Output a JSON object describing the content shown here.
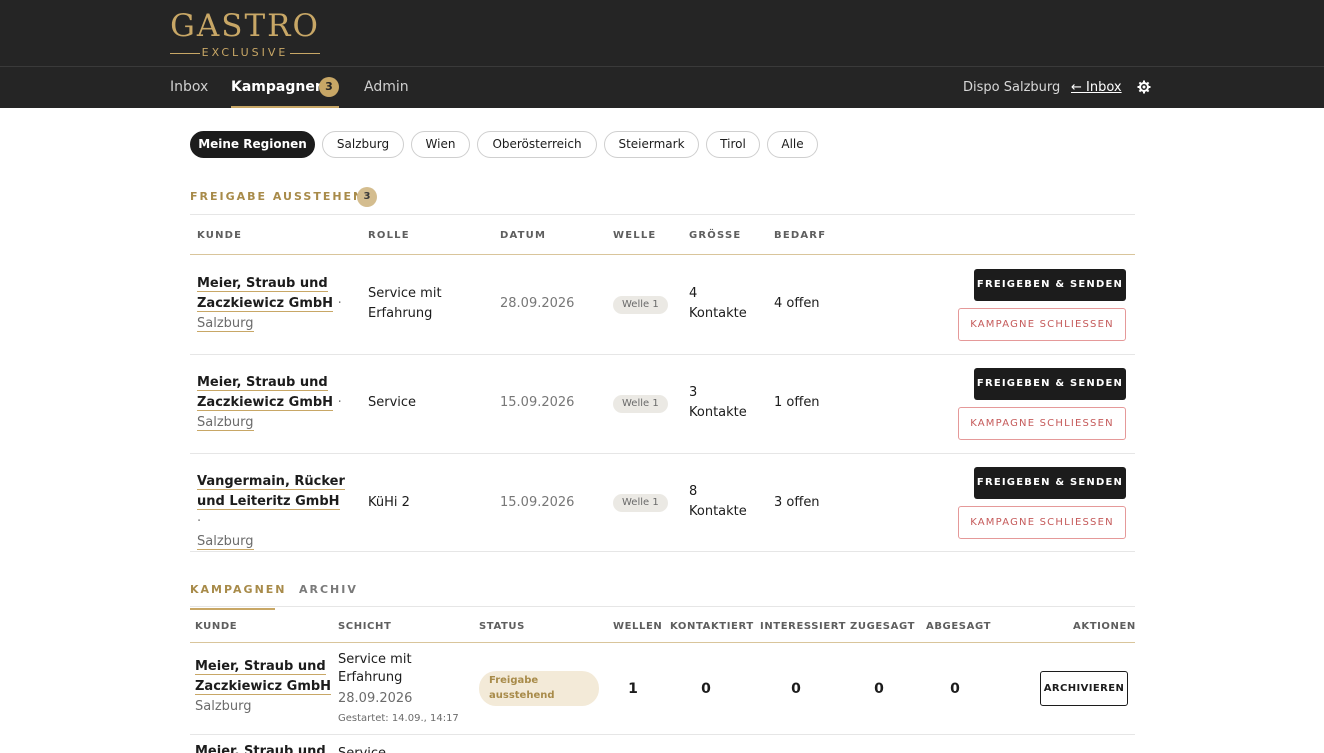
{
  "brand": {
    "name": "GASTRO",
    "sub": "EXCLUSIVE",
    "accent": "#c8a766"
  },
  "nav": {
    "items": [
      {
        "label": "Inbox"
      },
      {
        "label": "Kampagnen",
        "badge": "3"
      },
      {
        "label": "Admin"
      }
    ],
    "location": "Dispo Salzburg",
    "back_link": "← Inbox",
    "settings_icon": "gear-icon"
  },
  "filters": [
    "Meine Regionen",
    "Salzburg",
    "Wien",
    "Oberösterreich",
    "Steiermark",
    "Tirol",
    "Alle"
  ],
  "pending": {
    "title": "FREIGABE AUSSTEHEND",
    "count": "3",
    "columns": [
      "KUNDE",
      "ROLLE",
      "DATUM",
      "WELLE",
      "GRÖSSE",
      "BEDARF"
    ],
    "rows": [
      {
        "customer_l1": "Meier, Straub und",
        "customer_l2": "Zaczkiewicz GmbH",
        "sep": "·",
        "region": "Salzburg",
        "role_l1": "Service mit",
        "role_l2": "Erfahrung",
        "date": "28.09.2026",
        "wave": "Welle 1",
        "size_l1": "4",
        "size_l2": "Kontakte",
        "need": "4 offen",
        "btn_release": "FREIGEBEN & SENDEN",
        "btn_close": "KAMPAGNE SCHLIESSEN"
      },
      {
        "customer_l1": "Meier, Straub und",
        "customer_l2": "Zaczkiewicz GmbH",
        "sep": "·",
        "region": "Salzburg",
        "role_l1": "Service",
        "role_l2": "",
        "date": "15.09.2026",
        "wave": "Welle 1",
        "size_l1": "3",
        "size_l2": "Kontakte",
        "need": "1 offen",
        "btn_release": "FREIGEBEN & SENDEN",
        "btn_close": "KAMPAGNE SCHLIESSEN"
      },
      {
        "customer_l1": "Vangermain, Rücker",
        "customer_l2": "und Leiteritz GmbH",
        "sep": "·",
        "region": "Salzburg",
        "role_l1": "KüHi 2",
        "role_l2": "",
        "date": "15.09.2026",
        "wave": "Welle 1",
        "size_l1": "8",
        "size_l2": "Kontakte",
        "need": "3 offen",
        "btn_release": "FREIGEBEN & SENDEN",
        "btn_close": "KAMPAGNE SCHLIESSEN"
      }
    ]
  },
  "campaigns": {
    "tabs": [
      "KAMPAGNEN",
      "ARCHIV"
    ],
    "columns": [
      "KUNDE",
      "SCHICHT",
      "STATUS",
      "WELLEN",
      "KONTAKTIERT",
      "INTERESSIERT",
      "ZUGESAGT",
      "ABGESAGT",
      "AKTIONEN"
    ],
    "rows": [
      {
        "customer_l1": "Meier, Straub und",
        "customer_l2": "Zaczkiewicz GmbH",
        "region": "Salzburg",
        "shift_l1": "Service mit",
        "shift_l2": "Erfahrung",
        "date": "28.09.2026",
        "started": "Gestartet: 14.09., 14:17",
        "status": "Freigabe ausstehend",
        "waves": "1",
        "contacted": "0",
        "interested": "0",
        "committed": "0",
        "declined": "0",
        "action": "ARCHIVIEREN"
      },
      {
        "customer_l1": "Meier, Straub und",
        "shift_l1": "Service"
      }
    ]
  }
}
